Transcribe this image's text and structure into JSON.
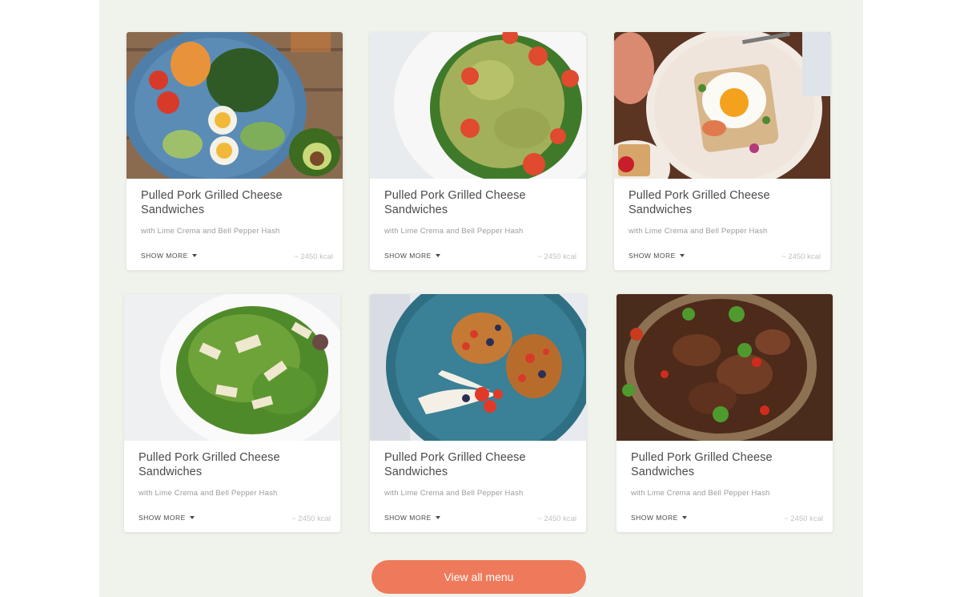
{
  "cards": [
    {
      "image": "salad-bowl-with-eggs-photo",
      "title": "Pulled Pork Grilled Cheese Sandwiches",
      "subtitle": "with Lime Crema and Bell Pepper Hash",
      "show_more": "SHOW MORE",
      "kcal": "~ 2450 kcal"
    },
    {
      "image": "pasta-salad-photo",
      "title": "Pulled Pork Grilled Cheese Sandwiches",
      "subtitle": "with Lime Crema and Bell Pepper Hash",
      "show_more": "SHOW MORE",
      "kcal": "~ 2450 kcal"
    },
    {
      "image": "egg-toast-plate-photo",
      "title": "Pulled Pork Grilled Cheese Sandwiches",
      "subtitle": "with Lime Crema and Bell Pepper Hash",
      "show_more": "SHOW MORE",
      "kcal": "~ 2450 kcal"
    },
    {
      "image": "green-bean-salad-photo",
      "title": "Pulled Pork Grilled Cheese Sandwiches",
      "subtitle": "with Lime Crema and Bell Pepper Hash",
      "show_more": "SHOW MORE",
      "kcal": "~ 2450 kcal"
    },
    {
      "image": "french-toast-berries-photo",
      "title": "Pulled Pork Grilled Cheese Sandwiches",
      "subtitle": "with Lime Crema and Bell Pepper Hash",
      "show_more": "SHOW MORE",
      "kcal": "~ 2450 kcal"
    },
    {
      "image": "meat-stew-pan-photo",
      "title": "Pulled Pork Grilled Cheese Sandwiches",
      "subtitle": "with Lime Crema and Bell Pepper Hash",
      "show_more": "SHOW MORE",
      "kcal": "~ 2450 kcal"
    }
  ],
  "cta": {
    "label": "View all menu"
  },
  "colors": {
    "background_panel": "#f0f3ec",
    "card": "#ffffff",
    "accent": "#ef7a5b",
    "title_text": "#4a4a4a",
    "muted_text": "#9b9b9b"
  }
}
